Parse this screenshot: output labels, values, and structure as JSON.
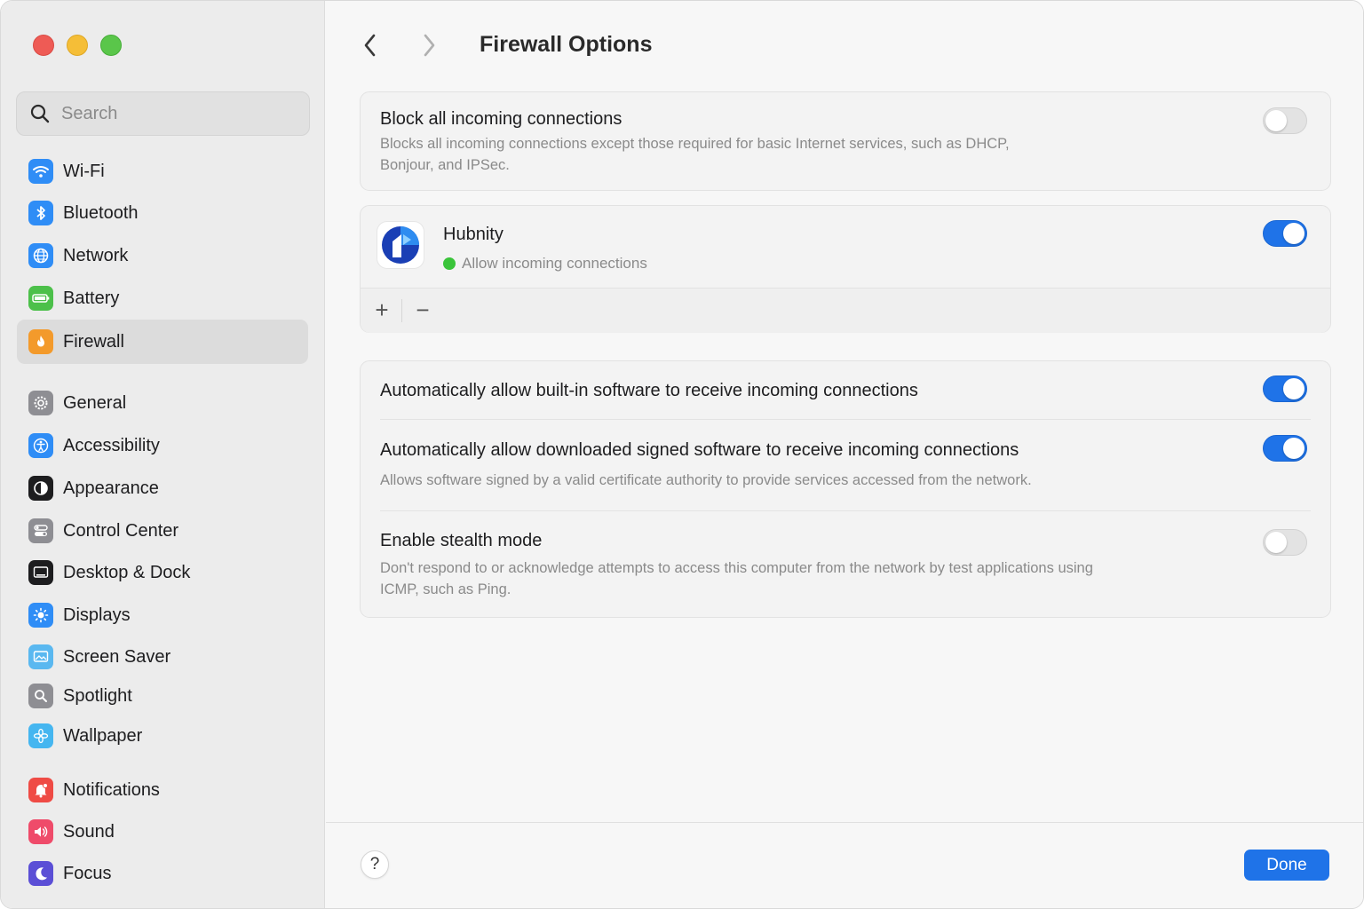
{
  "window": {
    "colors": {
      "accent": "#1f73e8",
      "close": "#ee5b55",
      "minimize": "#f5be37",
      "zoom": "#5ac64a"
    }
  },
  "sidebar": {
    "search_placeholder": "Search",
    "items": [
      {
        "label": "Wi-Fi",
        "icon": "wifi-icon",
        "color": "#2f8df6"
      },
      {
        "label": "Bluetooth",
        "icon": "bluetooth-icon",
        "color": "#2f8df6"
      },
      {
        "label": "Network",
        "icon": "globe-icon",
        "color": "#2f8df6"
      },
      {
        "label": "Battery",
        "icon": "battery-icon",
        "color": "#4cc04a"
      },
      {
        "label": "Firewall",
        "icon": "flame-icon",
        "color": "#f39a2b",
        "selected": true
      },
      {
        "label": "General",
        "icon": "gear-icon",
        "color": "#8e8e93"
      },
      {
        "label": "Accessibility",
        "icon": "accessibility-icon",
        "color": "#2f8df6"
      },
      {
        "label": "Appearance",
        "icon": "appearance-icon",
        "color": "#1d1d1f"
      },
      {
        "label": "Control Center",
        "icon": "control-center-icon",
        "color": "#8e8e93"
      },
      {
        "label": "Desktop & Dock",
        "icon": "dock-icon",
        "color": "#1d1d1f"
      },
      {
        "label": "Displays",
        "icon": "sun-icon",
        "color": "#2f8df6"
      },
      {
        "label": "Screen Saver",
        "icon": "screen-saver-icon",
        "color": "#5ab8f0"
      },
      {
        "label": "Spotlight",
        "icon": "magnifier-icon",
        "color": "#8e8e93"
      },
      {
        "label": "Wallpaper",
        "icon": "flower-icon",
        "color": "#45b6f0"
      },
      {
        "label": "Notifications",
        "icon": "bell-icon",
        "color": "#ef4b45"
      },
      {
        "label": "Sound",
        "icon": "speaker-icon",
        "color": "#ef4b6a"
      },
      {
        "label": "Focus",
        "icon": "moon-icon",
        "color": "#5b4fd6"
      }
    ]
  },
  "header": {
    "title": "Firewall Options",
    "back_icon": "chevron-left-icon",
    "forward_icon": "chevron-right-icon"
  },
  "block_all": {
    "title": "Block all incoming connections",
    "description_line1": "Blocks all incoming connections except those required for basic Internet services, such as DHCP,",
    "description_line2": "Bonjour, and IPSec.",
    "enabled": false
  },
  "apps": {
    "items": [
      {
        "name": "Hubnity",
        "status": "Allow incoming connections",
        "status_color": "#3ac43a",
        "enabled": true
      }
    ],
    "add_label": "+",
    "remove_label": "−"
  },
  "options": [
    {
      "title": "Automatically allow built-in software to receive incoming connections",
      "description": "",
      "enabled": true
    },
    {
      "title": "Automatically allow downloaded signed software to receive incoming connections",
      "description": "Allows software signed by a valid certificate authority to provide services accessed from the network.",
      "enabled": true
    },
    {
      "title": "Enable stealth mode",
      "description_line1": "Don't respond to or acknowledge attempts to access this computer from the network by test applications using",
      "description_line2": "ICMP, such as Ping.",
      "enabled": false
    }
  ],
  "footer": {
    "help_label": "?",
    "done_label": "Done"
  }
}
